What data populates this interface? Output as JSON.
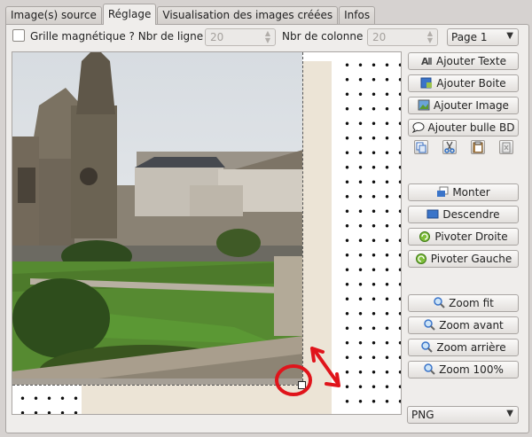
{
  "tabs": [
    {
      "label": "Image(s) source"
    },
    {
      "label": "Réglage"
    },
    {
      "label": "Visualisation des images créées"
    },
    {
      "label": "Infos"
    }
  ],
  "active_tab": 1,
  "grid": {
    "magnetic_label": "Grille magnétique ? Nbr de ligne :",
    "rows_value": "20",
    "columns_label": "Nbr de colonne :",
    "columns_value": "20",
    "checked": false
  },
  "page_select": {
    "value": "Page 1"
  },
  "tools": {
    "add_text": "Ajouter Texte",
    "add_box": "Ajouter Boite",
    "add_image": "Ajouter Image",
    "add_bubble": "Ajouter bulle BD",
    "move_up": "Monter",
    "move_down": "Descendre",
    "rotate_right": "Pivoter Droite",
    "rotate_left": "Pivoter Gauche",
    "zoom_fit": "Zoom fit",
    "zoom_in": "Zoom avant",
    "zoom_out": "Zoom arrière",
    "zoom_100": "Zoom 100%"
  },
  "format_select": {
    "value": "PNG"
  },
  "colors": {
    "accent_red": "#e0141b",
    "page": "#ece4d6",
    "panel": "#efedeb"
  },
  "icons": [
    "text-icon",
    "box-icon",
    "image-icon",
    "speech-bubble-icon",
    "copy-icon",
    "cut-icon",
    "paste-icon",
    "delete-icon",
    "raise-icon",
    "lower-icon",
    "rotate-right-icon",
    "rotate-left-icon",
    "magnifier-icon"
  ]
}
